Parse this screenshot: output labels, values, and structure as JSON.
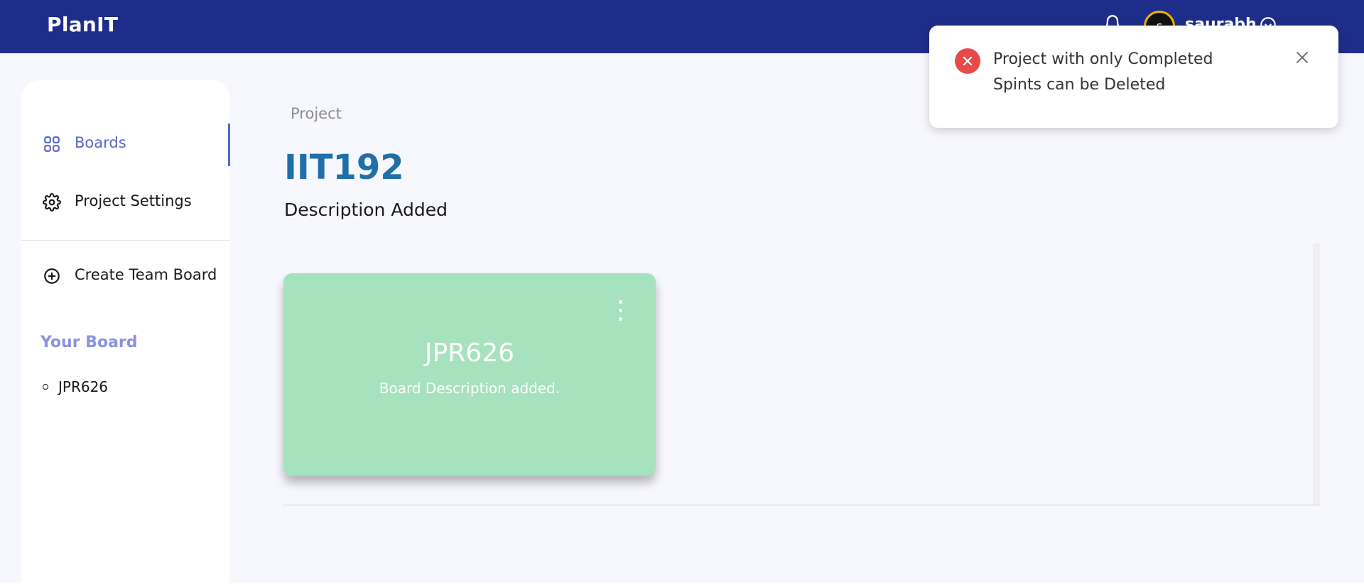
{
  "header": {
    "brand": "PlanIT",
    "avatar_initial": "s",
    "username": "saurabh"
  },
  "sidebar": {
    "items": [
      {
        "label": "Boards",
        "icon": "grid-icon"
      },
      {
        "label": "Project Settings",
        "icon": "gear-icon"
      },
      {
        "label": "Create Team Board",
        "icon": "plus-circle-icon"
      }
    ],
    "your_board_heading": "Your Board",
    "boards": [
      {
        "label": "JPR626"
      }
    ]
  },
  "main": {
    "breadcrumb": "Project",
    "title": "IIT192",
    "description": "Description Added",
    "board_cards": [
      {
        "title": "JPR626",
        "description": "Board Description added."
      }
    ]
  },
  "toast": {
    "type": "error",
    "message": "Project with only Completed Spints can be Deleted"
  },
  "colors": {
    "topbar": "#1f2d8a",
    "accent": "#5867c8",
    "project_title": "#1f6fa8",
    "board_card": "#a6e2be",
    "error": "#e74a4a"
  }
}
